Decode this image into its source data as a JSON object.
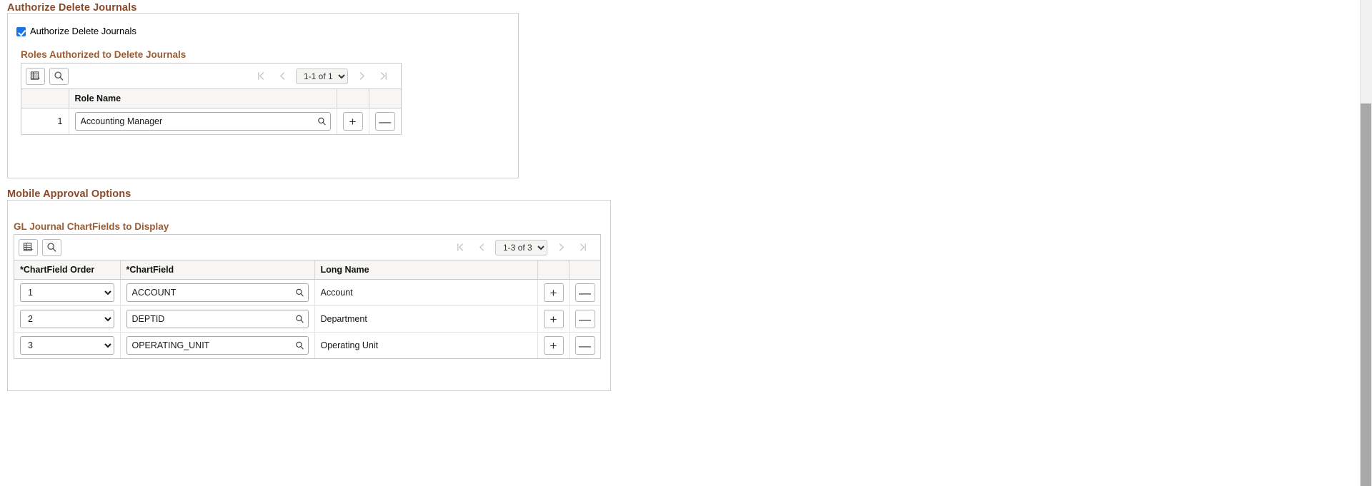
{
  "sections": {
    "authorize_delete": {
      "title": "Authorize Delete Journals",
      "checkbox_label": "Authorize Delete Journals",
      "checkbox_checked": true,
      "subgroup_title": "Roles Authorized to Delete Journals",
      "grid": {
        "toolbar": {
          "personalize_icon": "grid-personalize-icon",
          "find_icon": "search-icon"
        },
        "pager": {
          "first_icon": "first-page-icon",
          "prev_icon": "previous-page-icon",
          "next_icon": "next-page-icon",
          "last_icon": "last-page-icon",
          "range_label": "1-1 of 1",
          "range_options": [
            "1-1 of 1"
          ]
        },
        "columns": [
          "",
          "Role Name",
          "",
          ""
        ],
        "rows": [
          {
            "number": "1",
            "role_name": "Accounting Manager",
            "lookup_icon": "magnifier-icon",
            "add_label": "+",
            "remove_label": "—"
          }
        ]
      }
    },
    "mobile_approval": {
      "title": "Mobile Approval Options",
      "subgroup_title": "GL Journal ChartFields to Display",
      "grid": {
        "toolbar": {
          "personalize_icon": "grid-personalize-icon",
          "find_icon": "search-icon"
        },
        "pager": {
          "first_icon": "first-page-icon",
          "prev_icon": "previous-page-icon",
          "next_icon": "next-page-icon",
          "last_icon": "last-page-icon",
          "range_label": "1-3 of 3",
          "range_options": [
            "1-3 of 3"
          ]
        },
        "columns": [
          "*ChartField Order",
          "*ChartField",
          "Long Name",
          "",
          ""
        ],
        "order_options": [
          "1",
          "2",
          "3"
        ],
        "rows": [
          {
            "order": "1",
            "chartfield": "ACCOUNT",
            "long_name": "Account",
            "lookup_icon": "magnifier-icon",
            "add_label": "+",
            "remove_label": "—"
          },
          {
            "order": "2",
            "chartfield": "DEPTID",
            "long_name": "Department",
            "lookup_icon": "magnifier-icon",
            "add_label": "+",
            "remove_label": "—"
          },
          {
            "order": "3",
            "chartfield": "OPERATING_UNIT",
            "long_name": "Operating Unit",
            "lookup_icon": "magnifier-icon",
            "add_label": "+",
            "remove_label": "—"
          }
        ]
      }
    }
  },
  "scrollbar": {
    "name": "vertical-scrollbar",
    "thumb_name": "vertical-scrollbar-thumb"
  },
  "colors": {
    "heading": "#8a4a2a",
    "subheading": "#9b5c33",
    "checkbox_accent": "#1a73e8",
    "grid_header_bg": "#f7f6f4",
    "border": "#c8c8c8"
  }
}
